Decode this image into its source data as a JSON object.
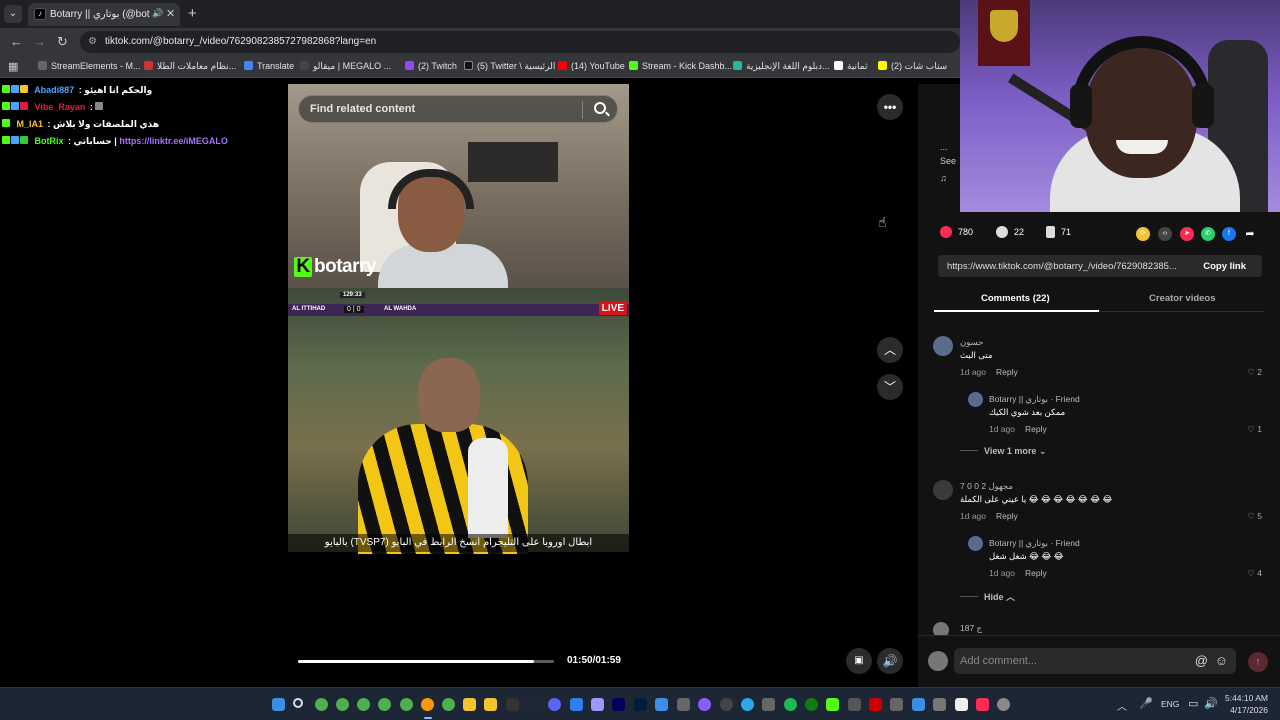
{
  "browser": {
    "tab_title": "Botarry || بوتاري (@botarry_",
    "url": "tiktok.com/@botarry_/video/7629082385727982868?lang=en",
    "bookmarks": [
      {
        "label": "StreamElements - M...",
        "color": "#666"
      },
      {
        "label": "نظام معاملات الطلا...",
        "color": "#c33"
      },
      {
        "label": "Translate",
        "color": "#4285f4"
      },
      {
        "label": "ميقالو | MEGALO ...",
        "color": "#333"
      },
      {
        "label": "(2) Twitch",
        "color": "#9146ff"
      },
      {
        "label": "(5) Twitter \\ الرئيسية",
        "color": "#111"
      },
      {
        "label": "(14) YouTube",
        "color": "#f00"
      },
      {
        "label": "Stream - Kick Dashb...",
        "color": "#53fc18"
      },
      {
        "label": "دبلوم اللغة الإنجليزية...",
        "color": "#2b9"
      },
      {
        "label": "ثمانية",
        "color": "#fff"
      },
      {
        "label": "(2) سناب شات",
        "color": "#fffc00"
      }
    ]
  },
  "chat": [
    {
      "name": "Abadi887",
      "name_color": "#4aa3ff",
      "message": "والحكم انا اهيئو",
      "link": ""
    },
    {
      "name": "Vibe_Rayan",
      "name_color": "#e01b3c",
      "message": "",
      "link": ""
    },
    {
      "name": "M_IA1",
      "name_color": "#f4c430",
      "message": "هذي الملصقات ولا بلاش",
      "link": ""
    },
    {
      "name": "BotRix",
      "name_color": "#53fc18",
      "message": "حساباتي |",
      "link": "https://linktr.ee/iMEGALO"
    }
  ],
  "video": {
    "search_placeholder": "Find related content",
    "watermark": "botarry",
    "live_badge": "LIVE",
    "score_home": "AL ITTIHAD",
    "score_away": "AL WAHDA",
    "score_value": "0 | 0",
    "match_clock": "129:33",
    "subtitle": "ابطال اوروبا على التليجرام انسخ الرابط في البايو (TVSP7) بالبايو",
    "timecode": "01:50/01:59",
    "progress": 0.92
  },
  "side": {
    "info_lines": [
      "...",
      "See"
    ]
  },
  "actions": {
    "likes": "780",
    "comments": "22",
    "saves": "71"
  },
  "share_link": "https://www.tiktok.com/@botarry_/video/7629082385...",
  "copy_link_label": "Copy link",
  "tabs": {
    "comments": "Comments (22)",
    "creator": "Creator videos"
  },
  "comments": [
    {
      "name": "حسون",
      "text": "متى البث",
      "time": "1d ago",
      "reply": "Reply",
      "likes": "2"
    },
    {
      "name": "Botarry || بوتاري · Friend",
      "text": "ممكن بعد شوي الكيك",
      "time": "1d ago",
      "reply": "Reply",
      "likes": "1"
    },
    {
      "name": "مجهول 2 0 0 7",
      "text": "يا عيني على الكملة 😂 😂 😂 😂 😂 😂 😂",
      "time": "1d ago",
      "reply": "Reply",
      "likes": "5"
    },
    {
      "name": "Botarry || بوتاري · Friend",
      "text": "شغل شغل 😂 😂 😂",
      "time": "1d ago",
      "reply": "Reply",
      "likes": "4"
    },
    {
      "name": "187 ج",
      "text": "",
      "time": "",
      "reply": "",
      "likes": ""
    }
  ],
  "view_more": "View 1 more",
  "hide": "Hide",
  "add_comment_placeholder": "Add comment...",
  "taskbar": {
    "lang": "ENG",
    "time": "5:44:10 AM",
    "date": "4/17/2026"
  }
}
